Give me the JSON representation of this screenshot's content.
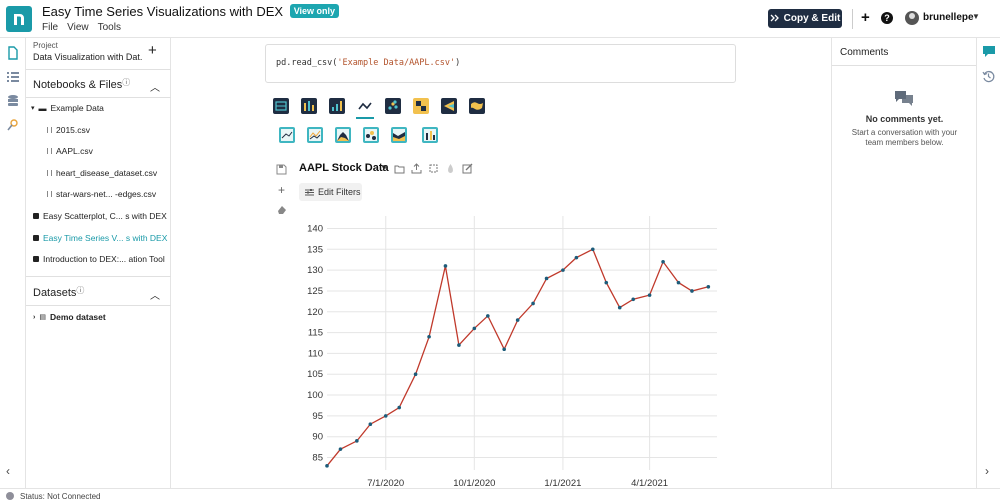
{
  "header": {
    "title": "Easy Time Series Visualizations with DEX",
    "badge": "View only",
    "menus": [
      "File",
      "View",
      "Tools"
    ],
    "copy_edit_label": "Copy & Edit",
    "username": "brunellepe"
  },
  "left_panel": {
    "project_label": "Project",
    "project_name": "Data Visualization with Dat...",
    "notebooks_title": "Notebooks & Files",
    "folder": "Example Data",
    "files": [
      "2015.csv",
      "AAPL.csv",
      "heart_disease_dataset.csv",
      "star-wars-net...  -edges.csv"
    ],
    "notebooks": [
      "Easy Scatterplot, C...  s with DEX",
      "Easy Time Series V...  s with DEX",
      "Introduction to DEX:...  ation Tool"
    ],
    "active_notebook_index": 1,
    "datasets_title": "Datasets",
    "dataset_item": "Demo dataset"
  },
  "center": {
    "code": {
      "prefix": "pd.read_csv(",
      "string": "'Example Data/AAPL.csv'",
      "suffix": ")"
    },
    "chart_types": [
      "grid-icon",
      "bar-icon",
      "bar-icon",
      "line-icon",
      "scatter-icon",
      "heatmap-icon",
      "spectrum-icon",
      "map-icon"
    ],
    "selected_chart_type_index": 3,
    "chart_subtypes": [
      "line-icon",
      "line-icon",
      "area-icon",
      "scatter-icon",
      "area-icon",
      "bar-icon"
    ],
    "dataset_title": "AAPL Stock Data",
    "filters_label": "Edit Filters"
  },
  "chart_data": {
    "type": "line",
    "x_tick_labels": [
      "7/1/2020",
      "10/1/2020",
      "1/1/2021",
      "4/1/2021"
    ],
    "y_ticks": [
      85,
      90,
      95,
      100,
      105,
      110,
      115,
      120,
      125,
      130,
      135,
      140
    ],
    "ylim": [
      82,
      143
    ],
    "series": [
      {
        "color": "#c0392b",
        "marker_color": "#1d5c7a",
        "x": [
          "5/1/2020",
          "5/15/2020",
          "6/1/2020",
          "6/15/2020",
          "7/1/2020",
          "7/15/2020",
          "8/1/2020",
          "8/15/2020",
          "9/1/2020",
          "9/15/2020",
          "10/1/2020",
          "10/15/2020",
          "11/1/2020",
          "11/15/2020",
          "12/1/2020",
          "12/15/2020",
          "1/1/2021",
          "1/15/2021",
          "2/1/2021",
          "2/15/2021",
          "3/1/2021",
          "3/15/2021",
          "4/1/2021",
          "4/15/2021",
          "5/1/2021",
          "5/15/2021",
          "6/1/2021"
        ],
        "values": [
          83,
          87,
          89,
          93,
          95,
          97,
          105,
          114,
          131,
          112,
          116,
          119,
          111,
          118,
          122,
          128,
          130,
          133,
          135,
          127,
          121,
          123,
          124,
          132,
          127,
          125,
          126
        ]
      }
    ]
  },
  "comments": {
    "title": "Comments",
    "empty_title": "No comments yet.",
    "empty_sub": "Start a conversation with your team members below."
  },
  "status": {
    "text": "Status: Not Connected"
  },
  "colors": {
    "brand": "#1a9aa8",
    "header_button": "#1f2d42",
    "series": "#c0392b"
  }
}
